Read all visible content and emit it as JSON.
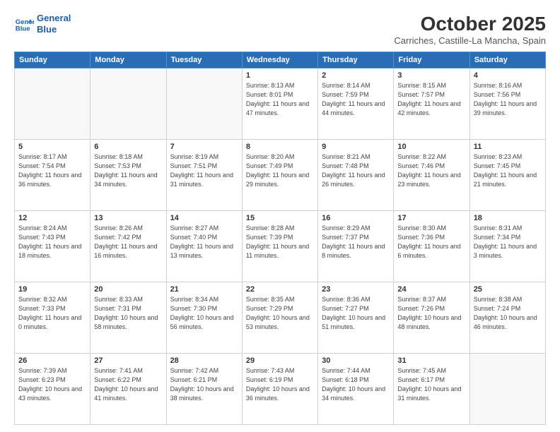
{
  "header": {
    "logo_line1": "General",
    "logo_line2": "Blue",
    "month": "October 2025",
    "location": "Carriches, Castille-La Mancha, Spain"
  },
  "weekdays": [
    "Sunday",
    "Monday",
    "Tuesday",
    "Wednesday",
    "Thursday",
    "Friday",
    "Saturday"
  ],
  "weeks": [
    [
      {
        "day": "",
        "info": ""
      },
      {
        "day": "",
        "info": ""
      },
      {
        "day": "",
        "info": ""
      },
      {
        "day": "1",
        "info": "Sunrise: 8:13 AM\nSunset: 8:01 PM\nDaylight: 11 hours and 47 minutes."
      },
      {
        "day": "2",
        "info": "Sunrise: 8:14 AM\nSunset: 7:59 PM\nDaylight: 11 hours and 44 minutes."
      },
      {
        "day": "3",
        "info": "Sunrise: 8:15 AM\nSunset: 7:57 PM\nDaylight: 11 hours and 42 minutes."
      },
      {
        "day": "4",
        "info": "Sunrise: 8:16 AM\nSunset: 7:56 PM\nDaylight: 11 hours and 39 minutes."
      }
    ],
    [
      {
        "day": "5",
        "info": "Sunrise: 8:17 AM\nSunset: 7:54 PM\nDaylight: 11 hours and 36 minutes."
      },
      {
        "day": "6",
        "info": "Sunrise: 8:18 AM\nSunset: 7:53 PM\nDaylight: 11 hours and 34 minutes."
      },
      {
        "day": "7",
        "info": "Sunrise: 8:19 AM\nSunset: 7:51 PM\nDaylight: 11 hours and 31 minutes."
      },
      {
        "day": "8",
        "info": "Sunrise: 8:20 AM\nSunset: 7:49 PM\nDaylight: 11 hours and 29 minutes."
      },
      {
        "day": "9",
        "info": "Sunrise: 8:21 AM\nSunset: 7:48 PM\nDaylight: 11 hours and 26 minutes."
      },
      {
        "day": "10",
        "info": "Sunrise: 8:22 AM\nSunset: 7:46 PM\nDaylight: 11 hours and 23 minutes."
      },
      {
        "day": "11",
        "info": "Sunrise: 8:23 AM\nSunset: 7:45 PM\nDaylight: 11 hours and 21 minutes."
      }
    ],
    [
      {
        "day": "12",
        "info": "Sunrise: 8:24 AM\nSunset: 7:43 PM\nDaylight: 11 hours and 18 minutes."
      },
      {
        "day": "13",
        "info": "Sunrise: 8:26 AM\nSunset: 7:42 PM\nDaylight: 11 hours and 16 minutes."
      },
      {
        "day": "14",
        "info": "Sunrise: 8:27 AM\nSunset: 7:40 PM\nDaylight: 11 hours and 13 minutes."
      },
      {
        "day": "15",
        "info": "Sunrise: 8:28 AM\nSunset: 7:39 PM\nDaylight: 11 hours and 11 minutes."
      },
      {
        "day": "16",
        "info": "Sunrise: 8:29 AM\nSunset: 7:37 PM\nDaylight: 11 hours and 8 minutes."
      },
      {
        "day": "17",
        "info": "Sunrise: 8:30 AM\nSunset: 7:36 PM\nDaylight: 11 hours and 6 minutes."
      },
      {
        "day": "18",
        "info": "Sunrise: 8:31 AM\nSunset: 7:34 PM\nDaylight: 11 hours and 3 minutes."
      }
    ],
    [
      {
        "day": "19",
        "info": "Sunrise: 8:32 AM\nSunset: 7:33 PM\nDaylight: 11 hours and 0 minutes."
      },
      {
        "day": "20",
        "info": "Sunrise: 8:33 AM\nSunset: 7:31 PM\nDaylight: 10 hours and 58 minutes."
      },
      {
        "day": "21",
        "info": "Sunrise: 8:34 AM\nSunset: 7:30 PM\nDaylight: 10 hours and 56 minutes."
      },
      {
        "day": "22",
        "info": "Sunrise: 8:35 AM\nSunset: 7:29 PM\nDaylight: 10 hours and 53 minutes."
      },
      {
        "day": "23",
        "info": "Sunrise: 8:36 AM\nSunset: 7:27 PM\nDaylight: 10 hours and 51 minutes."
      },
      {
        "day": "24",
        "info": "Sunrise: 8:37 AM\nSunset: 7:26 PM\nDaylight: 10 hours and 48 minutes."
      },
      {
        "day": "25",
        "info": "Sunrise: 8:38 AM\nSunset: 7:24 PM\nDaylight: 10 hours and 46 minutes."
      }
    ],
    [
      {
        "day": "26",
        "info": "Sunrise: 7:39 AM\nSunset: 6:23 PM\nDaylight: 10 hours and 43 minutes."
      },
      {
        "day": "27",
        "info": "Sunrise: 7:41 AM\nSunset: 6:22 PM\nDaylight: 10 hours and 41 minutes."
      },
      {
        "day": "28",
        "info": "Sunrise: 7:42 AM\nSunset: 6:21 PM\nDaylight: 10 hours and 38 minutes."
      },
      {
        "day": "29",
        "info": "Sunrise: 7:43 AM\nSunset: 6:19 PM\nDaylight: 10 hours and 36 minutes."
      },
      {
        "day": "30",
        "info": "Sunrise: 7:44 AM\nSunset: 6:18 PM\nDaylight: 10 hours and 34 minutes."
      },
      {
        "day": "31",
        "info": "Sunrise: 7:45 AM\nSunset: 6:17 PM\nDaylight: 10 hours and 31 minutes."
      },
      {
        "day": "",
        "info": ""
      }
    ]
  ]
}
